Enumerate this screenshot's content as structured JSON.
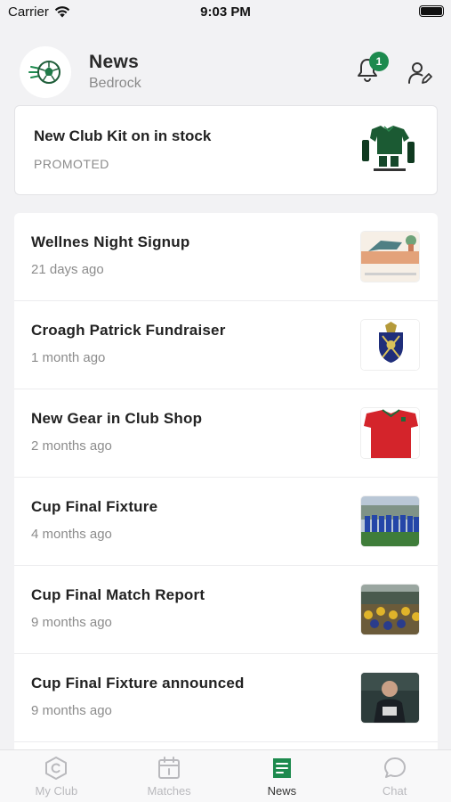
{
  "status_bar": {
    "carrier": "Carrier",
    "time": "9:03 PM"
  },
  "header": {
    "title": "News",
    "subtitle": "Bedrock",
    "notification_count": "1"
  },
  "promoted": {
    "title": "New Club Kit on in stock",
    "tag": "PROMOTED",
    "thumb_icon": "green-kit-image"
  },
  "news": [
    {
      "title": "Wellnes Night Signup",
      "date": "21 days ago",
      "thumb_icon": "wellness-poster-image"
    },
    {
      "title": "Croagh Patrick Fundraiser",
      "date": "1 month ago",
      "thumb_icon": "crest-image"
    },
    {
      "title": "New Gear in Club Shop",
      "date": "2 months ago",
      "thumb_icon": "red-jersey-image"
    },
    {
      "title": "Cup Final Fixture",
      "date": "4 months ago",
      "thumb_icon": "team-photo-image"
    },
    {
      "title": "Cup Final Match Report",
      "date": "9 months ago",
      "thumb_icon": "match-crowd-image"
    },
    {
      "title": "Cup Final Fixture announced",
      "date": "9 months ago",
      "thumb_icon": "coach-photo-image"
    }
  ],
  "tabs": [
    {
      "label": "My Club",
      "icon": "club-icon",
      "active": false
    },
    {
      "label": "Matches",
      "icon": "calendar-icon",
      "active": false
    },
    {
      "label": "News",
      "icon": "news-icon",
      "active": true
    },
    {
      "label": "Chat",
      "icon": "chat-icon",
      "active": false
    }
  ],
  "colors": {
    "accent": "#1d8a4e",
    "background": "#f2f2f4",
    "inactive_tab": "#b9b9bd"
  }
}
